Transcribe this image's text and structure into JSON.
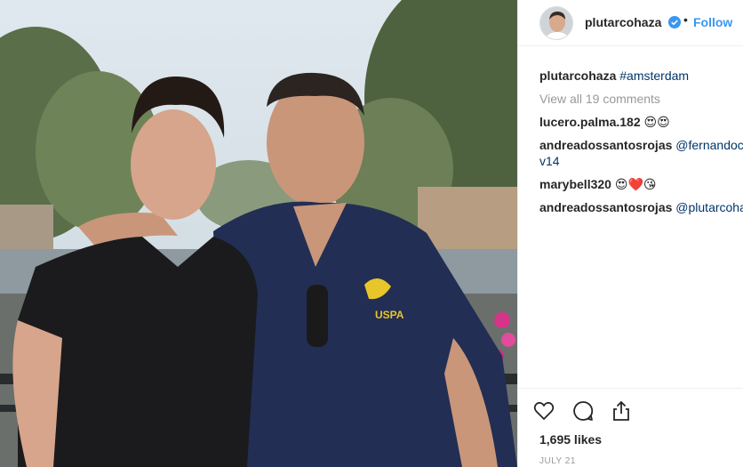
{
  "post": {
    "image_alt": "Two men posing in front of an Amsterdam canal",
    "logo_text": "USPA"
  },
  "header": {
    "username": "plutarcohaza",
    "separator": "•",
    "follow_label": "Follow",
    "verified_icon": "verified-badge-icon"
  },
  "comments": {
    "caption": {
      "user": "plutarcohaza",
      "text": "#amsterdam"
    },
    "view_all": "View all 19 comments",
    "items": [
      {
        "user": "lucero.palma.182",
        "text": "😍😍"
      },
      {
        "user": "andreadossantosrojas",
        "text": "@fernandoc",
        "continuation": "v14"
      },
      {
        "user": "marybell320",
        "text": "😍❤️😘"
      },
      {
        "user": "andreadossantosrojas",
        "text": "@plutarcoha"
      }
    ]
  },
  "actions": {
    "icons": [
      "heart-icon",
      "comment-icon",
      "share-icon"
    ],
    "likes": "1,695 likes",
    "date": "JULY 21"
  },
  "colors": {
    "accent": "#3897f0",
    "text": "#262626",
    "muted": "#999999",
    "hashtag": "#003569"
  }
}
